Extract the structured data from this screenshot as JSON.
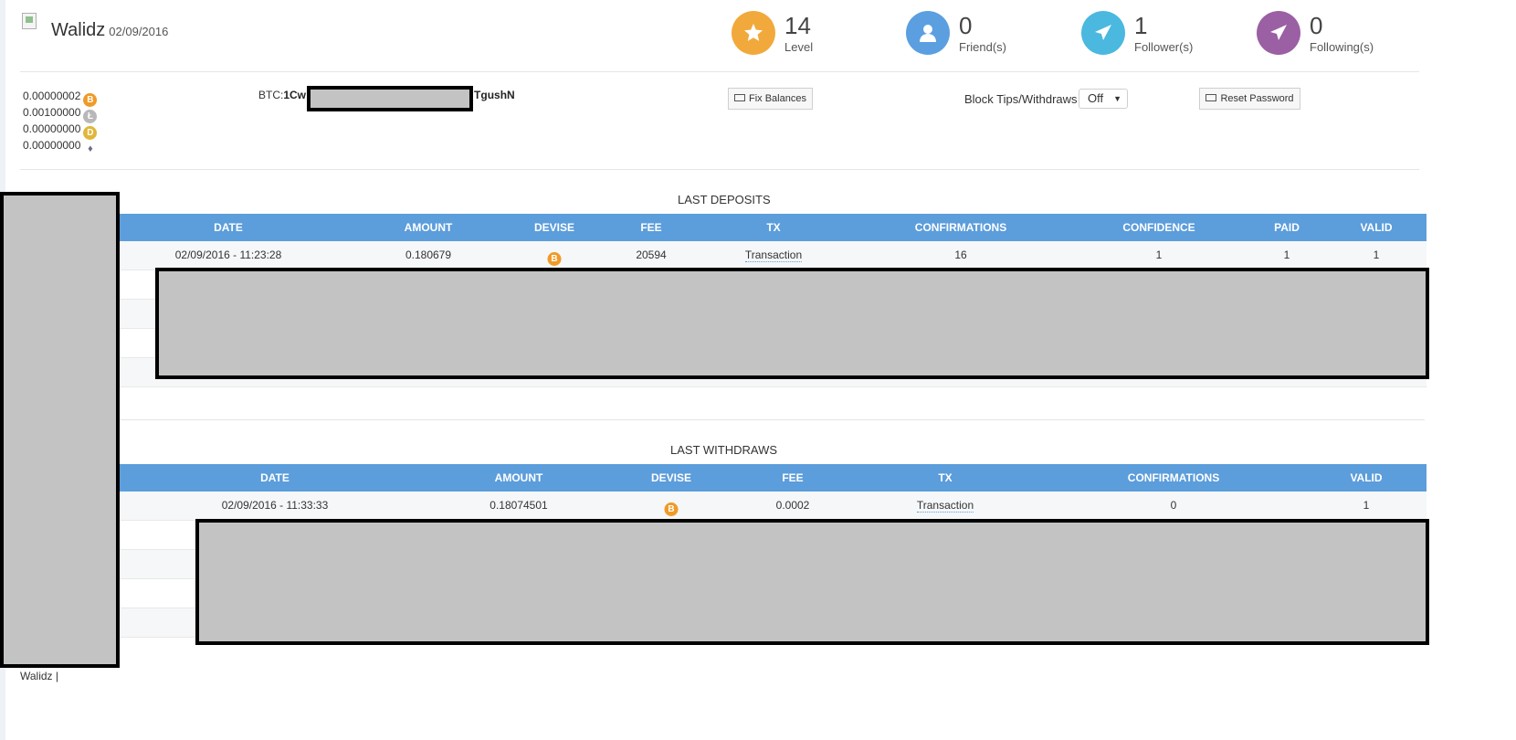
{
  "profile": {
    "username": "Walidz",
    "date": "02/09/2016"
  },
  "stats": [
    {
      "value": "14",
      "label": "Level",
      "color": "#f2a93b",
      "icon": "star-icon"
    },
    {
      "value": "0",
      "label": "Friend(s)",
      "color": "#5b9fe0",
      "icon": "user-icon"
    },
    {
      "value": "1",
      "label": "Follower(s)",
      "color": "#4bb8df",
      "icon": "paper-plane-icon"
    },
    {
      "value": "0",
      "label": "Following(s)",
      "color": "#9b5fa3",
      "icon": "paper-plane-icon"
    }
  ],
  "balances": [
    {
      "value": "0.00000002",
      "coin": "bitcoin-icon",
      "color": "#f09a28",
      "glyph": "B"
    },
    {
      "value": "0.00100000",
      "coin": "litecoin-icon",
      "color": "#b8b8b8",
      "glyph": "Ł"
    },
    {
      "value": "0.00000000",
      "coin": "dogecoin-icon",
      "color": "#e0b63a",
      "glyph": "D"
    },
    {
      "value": "0.00000000",
      "coin": "ethereum-icon",
      "color": "#6c6c8c",
      "glyph": "♦"
    }
  ],
  "btc_address": {
    "prefix": "BTC:",
    "start": "1Cw",
    "end": "TgushN"
  },
  "actions": {
    "fix_balances": "Fix Balances",
    "block_label": "Block Tips/Withdraws",
    "block_value": "Off",
    "reset_password": "Reset Password"
  },
  "deposits": {
    "title": "LAST DEPOSITS",
    "columns": [
      "DATE",
      "AMOUNT",
      "DEVISE",
      "FEE",
      "TX",
      "CONFIRMATIONS",
      "CONFIDENCE",
      "PAID",
      "VALID"
    ],
    "rows": [
      {
        "date": "02/09/2016 - 11:23:28",
        "amount": "0.180679",
        "fee": "20594",
        "tx": "Transaction",
        "confirmations": "16",
        "confidence": "1",
        "paid": "1",
        "valid": "1"
      }
    ]
  },
  "withdraws": {
    "title": "LAST WITHDRAWS",
    "columns": [
      "DATE",
      "AMOUNT",
      "DEVISE",
      "FEE",
      "TX",
      "CONFIRMATIONS",
      "VALID"
    ],
    "rows": [
      {
        "date": "02/09/2016 - 11:33:33",
        "amount": "0.18074501",
        "fee": "0.0002",
        "tx": "Transaction",
        "confirmations": "0",
        "valid": "1"
      }
    ]
  },
  "footer": {
    "text": "Walidz |"
  }
}
